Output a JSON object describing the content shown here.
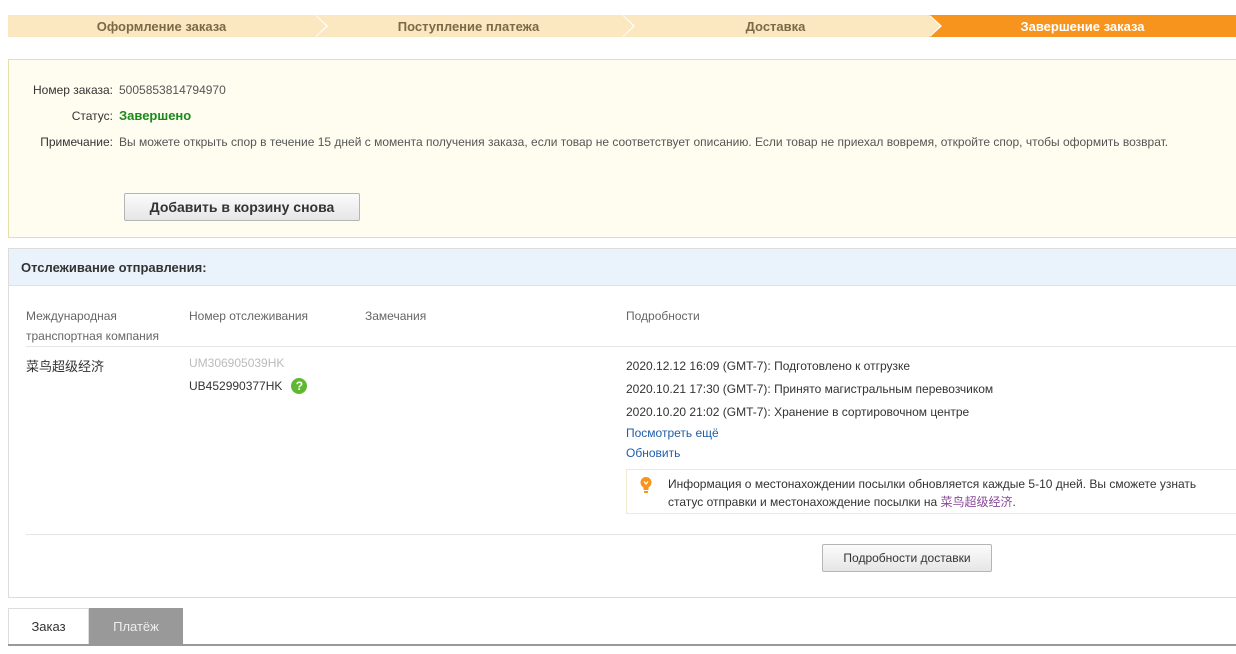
{
  "steps": [
    {
      "label": "Оформление заказа",
      "active": false
    },
    {
      "label": "Поступление платежа",
      "active": false
    },
    {
      "label": "Доставка",
      "active": false
    },
    {
      "label": "Завершение заказа",
      "active": true
    }
  ],
  "order": {
    "number_label": "Номер заказа:",
    "number_value": "5005853814794970",
    "status_label": "Статус:",
    "status_value": "Завершено",
    "note_label": "Примечание:",
    "note_value": "Вы можете открыть спор в течение 15 дней с момента получения заказа, если товар не соответствует описанию. Если товар не приехал вовремя, откройте спор, чтобы оформить возврат.",
    "add_to_cart_label": "Добавить в корзину снова"
  },
  "tracking": {
    "title": "Отслеживание отправления:",
    "columns": {
      "carrier": "Международная транспортная компания",
      "tracking_number": "Номер отслеживания",
      "remarks": "Замечания",
      "details": "Подробности"
    },
    "carrier_name": "菜鸟超级经济",
    "old_tracking_number": "UM306905039HK",
    "tracking_number": "UB452990377HK",
    "events": [
      "2020.12.12 16:09 (GMT-7): Подготовлено к отгрузке",
      "2020.10.21 17:30 (GMT-7): Принято магистральным перевозчиком",
      "2020.10.20 21:02 (GMT-7): Хранение в сортировочном центре"
    ],
    "see_more_label": "Посмотреть ещё",
    "refresh_label": "Обновить",
    "tip_text": "Информация о местонахождении посылки обновляется каждые 5-10 дней. Вы сможете узнать статус отправки и местонахождение посылки на ",
    "tip_link": "菜鸟超级经济",
    "tip_end": ".",
    "delivery_details_label": "Подробности доставки"
  },
  "tabs": [
    {
      "label": "Заказ",
      "active": true
    },
    {
      "label": "Платёж",
      "active": false
    }
  ]
}
